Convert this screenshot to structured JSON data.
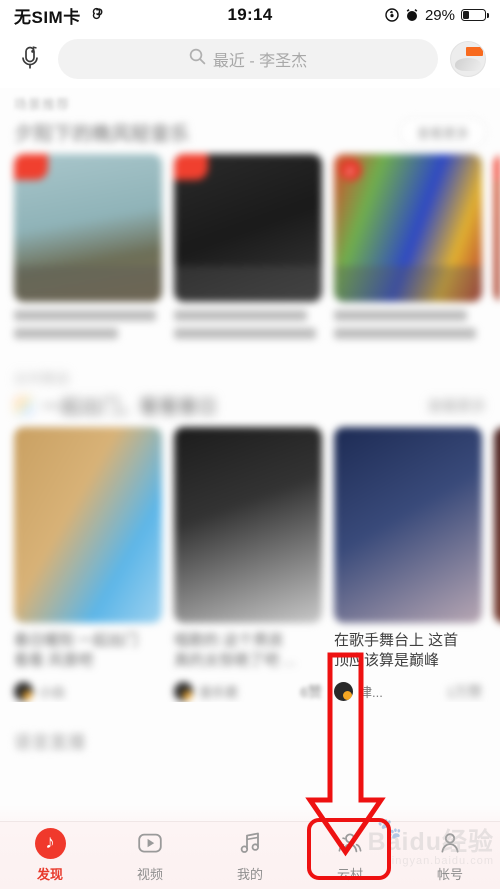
{
  "status_bar": {
    "carrier": "无SIM卡",
    "link_icon": "link-icon",
    "time": "19:14",
    "rotation_lock_icon": "rotation-lock-icon",
    "alarm_icon": "alarm-icon",
    "battery_percent": "29%",
    "battery_level": 29
  },
  "header": {
    "voice_search_icon": "microphone-music-icon",
    "search_icon": "search-icon",
    "search_placeholder": "最近 - 李圣杰",
    "search_value": "",
    "avatar_icon": "user-avatar"
  },
  "section_scene": {
    "kicker": "场景推荐",
    "title_visible": "夕阳下的",
    "title_blurred": "晚风轻音乐",
    "more_label": "查看更多",
    "cards": [
      {
        "title_line1": "行走在一个人的路上",
        "title_line2": "听着这首歌流泪",
        "badge": "hot-badge"
      },
      {
        "title_line1": "孤独的人总会被温柔",
        "title_line2": "的 夜色悄悄收留",
        "badge": "hot-badge"
      },
      {
        "title_line1": "夜色温柔你是星光",
        "title_line2": "想和你听这首歌",
        "badge": "netease-logo"
      },
      {
        "title_line1": "",
        "title_line2": "",
        "badge": "hot-badge"
      }
    ]
  },
  "section_video": {
    "kicker": "云村精选",
    "icon": "rainbow-square-icon",
    "title_visible": "一起出门，",
    "title_blurred": "看看春日",
    "more_label": "查看更多",
    "cards": [
      {
        "text_line1": "春日暖阳 一起出门",
        "text_line2": "看看 风景吧",
        "user": "小白",
        "likes": ""
      },
      {
        "text_line1": "唱歌的 这个男孩",
        "text_line2": "真的太惊艳了吧 ...",
        "user": "音乐君",
        "likes": "6赞"
      },
      {
        "text_line1": "在歌手舞台上 这首",
        "text_line2": "顶应该算是巅峰",
        "user": "律...",
        "likes": "1万赞"
      },
      {
        "text_line1": "",
        "text_line2": "",
        "user": "",
        "likes": ""
      }
    ]
  },
  "section_live": {
    "title": "语音直播"
  },
  "tab_bar": {
    "tabs": [
      {
        "label": "发现",
        "icon": "netease-cloud-music-logo",
        "active": true,
        "highlighted": false
      },
      {
        "label": "视频",
        "icon": "play-circle-icon",
        "active": false,
        "highlighted": false
      },
      {
        "label": "我的",
        "icon": "music-note-icon",
        "active": false,
        "highlighted": false
      },
      {
        "label": "云村",
        "icon": "people-group-icon",
        "active": false,
        "highlighted": true
      },
      {
        "label": "帐号",
        "icon": "person-icon",
        "active": false,
        "highlighted": false
      }
    ]
  },
  "annotation": {
    "arrow_icon": "red-down-arrow",
    "highlight_target": "云村",
    "accent_color": "#ee1111"
  },
  "watermark": {
    "main": "Baidu经验",
    "sub": "jingyan.baidu.com",
    "paw_icon": "baidu-paw-icon"
  }
}
